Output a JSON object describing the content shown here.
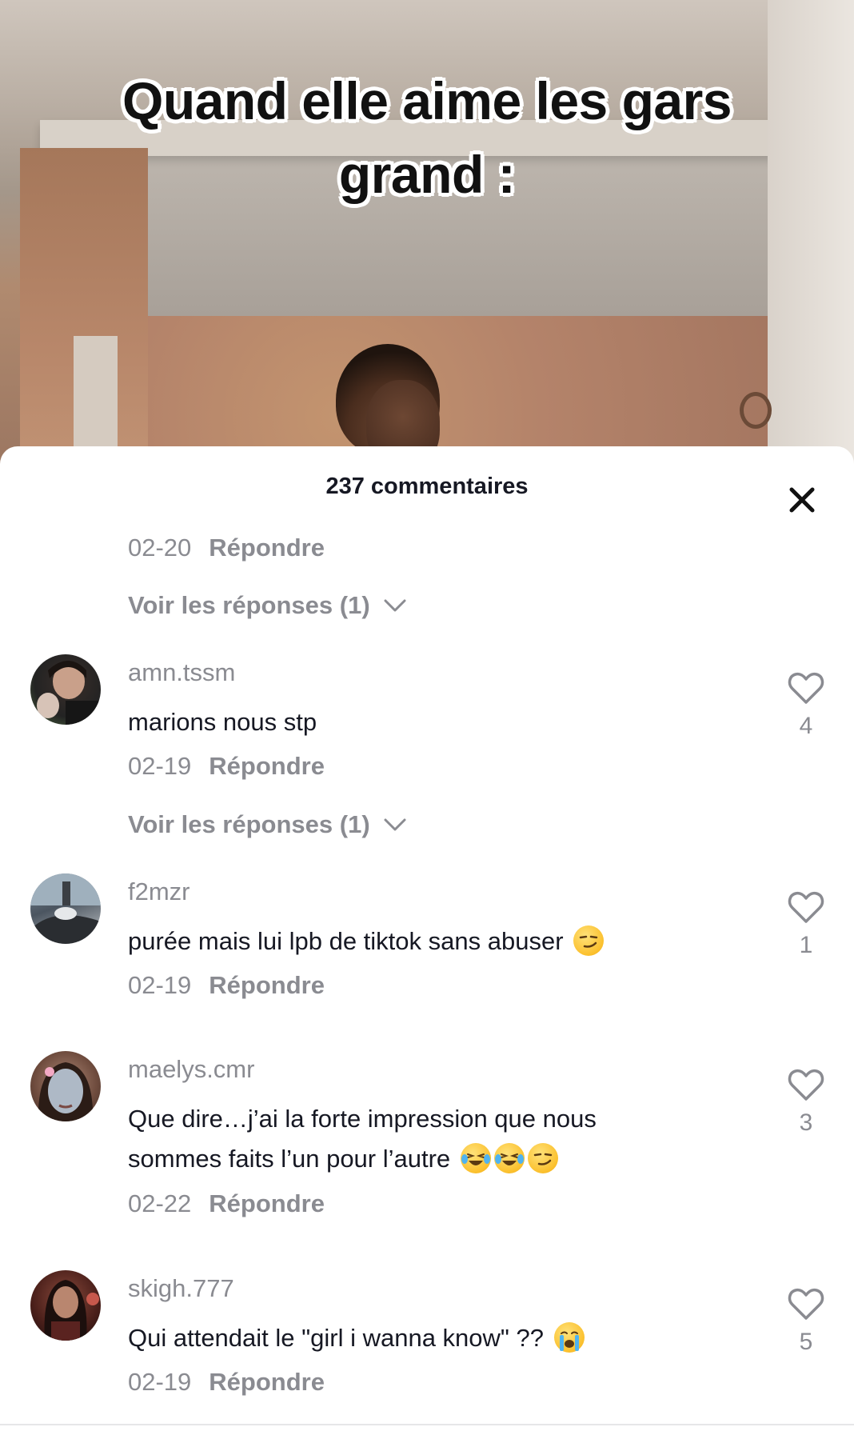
{
  "video": {
    "caption_line1": "Quand elle aime les gars",
    "caption_line2": "grand :"
  },
  "sheet": {
    "title": "237 commentaires",
    "close_icon": "close-icon"
  },
  "top_item": {
    "date": "02-20",
    "reply_label": "Répondre",
    "view_replies": "Voir les réponses (1)"
  },
  "comments": [
    {
      "username": "amn.tssm",
      "text": "marions nous stp",
      "date": "02-19",
      "reply_label": "Répondre",
      "likes": "4",
      "view_replies": "Voir les réponses (1)",
      "emojis": []
    },
    {
      "username": "f2mzr",
      "text": "purée mais lui lpb de tiktok sans abuser",
      "date": "02-19",
      "reply_label": "Répondre",
      "likes": "1",
      "emojis": [
        "smirking-face-emoji"
      ]
    },
    {
      "username": "maelys.cmr",
      "text_line1": "Que dire…j’ai la forte impression que nous",
      "text_line2": "sommes faits l’un pour l’autre",
      "date": "02-22",
      "reply_label": "Répondre",
      "likes": "3",
      "emojis": [
        "laughing-tears-emoji",
        "laughing-tears-emoji",
        "smirking-face-emoji"
      ]
    },
    {
      "username": "skigh.777",
      "text": "Qui attendait le \"girl i wanna know\" ??",
      "date": "02-19",
      "reply_label": "Répondre",
      "likes": "5",
      "emojis": [
        "loudly-crying-emoji"
      ]
    }
  ],
  "colors": {
    "primary_text": "#161823",
    "secondary_text": "#8a8b91",
    "sheet_bg": "#ffffff"
  }
}
